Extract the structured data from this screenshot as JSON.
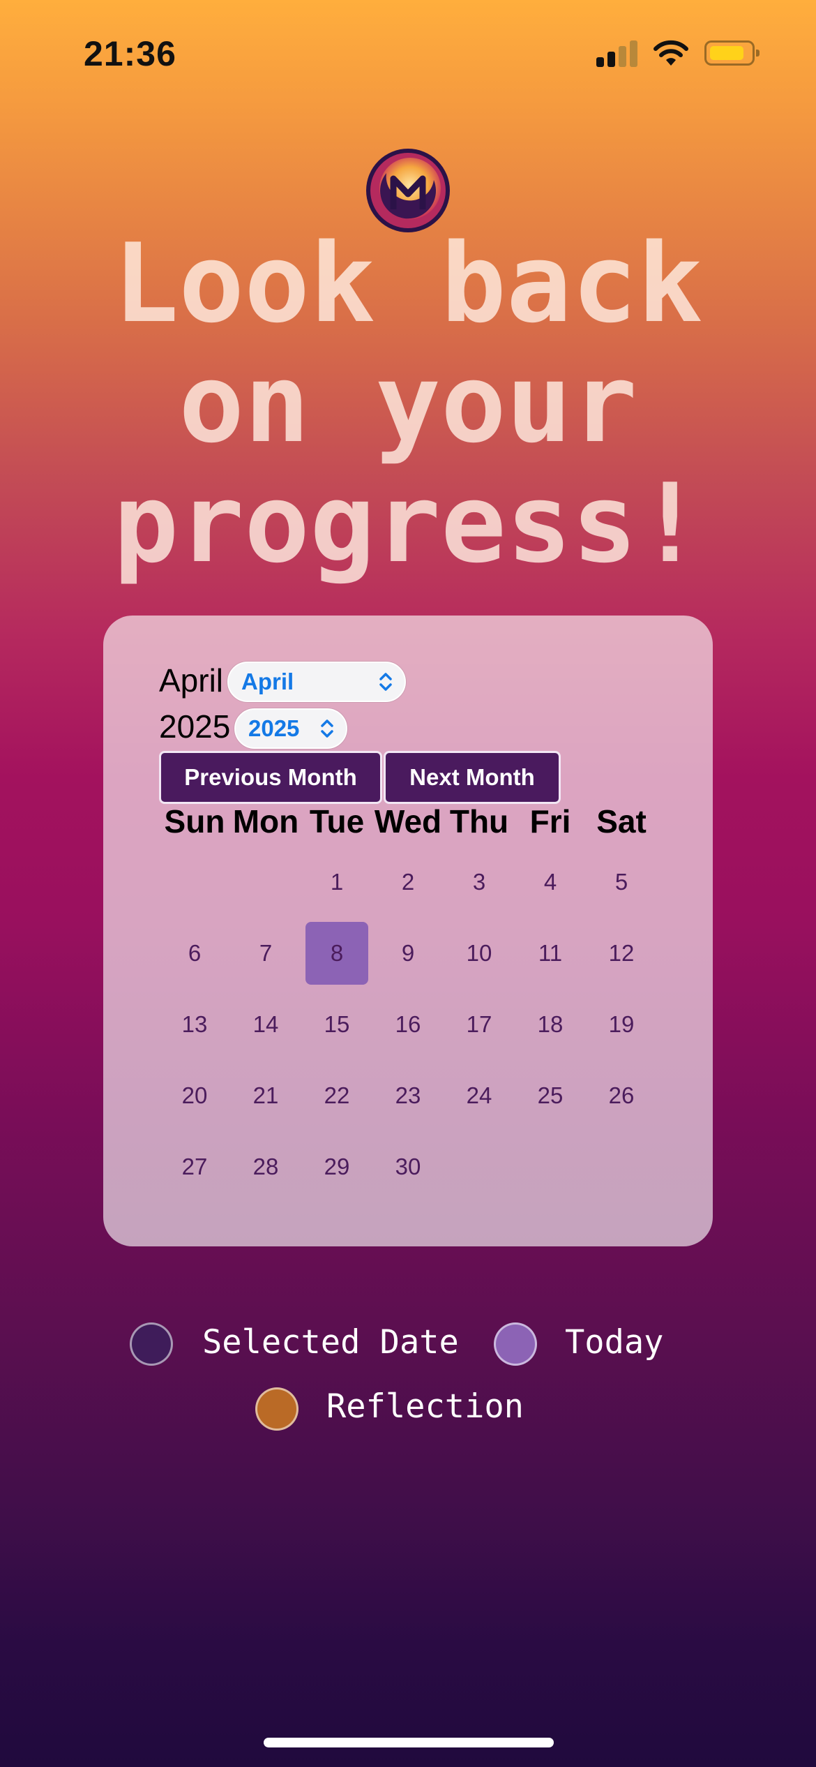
{
  "status_bar": {
    "time": "21:36"
  },
  "headline": {
    "lines": [
      "Look back",
      "on your",
      "progress!"
    ]
  },
  "calendar": {
    "month_label": "April",
    "month_select_value": "April",
    "year_label": "2025",
    "year_select_value": "2025",
    "prev_button": "Previous Month",
    "next_button": "Next Month",
    "weekdays": [
      "Sun",
      "Mon",
      "Tue",
      "Wed",
      "Thu",
      "Fri",
      "Sat"
    ],
    "days": [
      "1",
      "2",
      "3",
      "4",
      "5",
      "6",
      "7",
      "8",
      "9",
      "10",
      "11",
      "12",
      "13",
      "14",
      "15",
      "16",
      "17",
      "18",
      "19",
      "20",
      "21",
      "22",
      "23",
      "24",
      "25",
      "26",
      "27",
      "28",
      "29",
      "30"
    ],
    "today": "8"
  },
  "legend": {
    "selected_label": "Selected Date",
    "today_label": "Today",
    "reflection_label": "Reflection"
  },
  "colors": {
    "selected": "#3F1C5A",
    "today": "#8C63B5",
    "reflection": "#BA6A26",
    "button_bg": "#4A1A5E",
    "select_text": "#1479E6"
  }
}
